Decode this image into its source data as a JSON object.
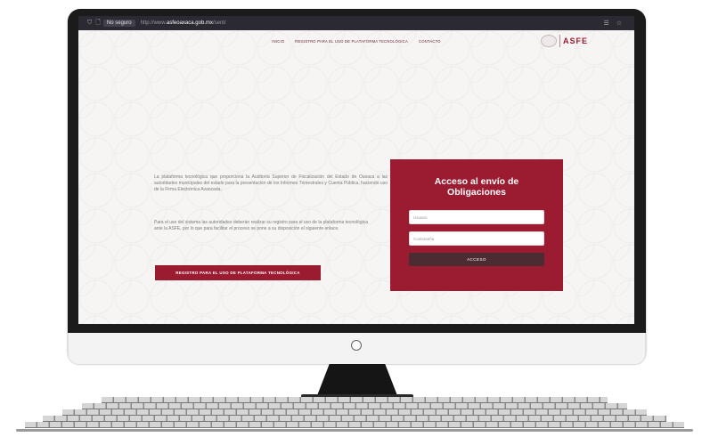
{
  "browser": {
    "insecure_label": "No seguro",
    "url_prefix": "http://www.",
    "url_domain": "asfeoaxaca.gob.mx",
    "url_path": "/sent/"
  },
  "nav": {
    "items": [
      {
        "label": "INICIO"
      },
      {
        "label": "REGISTRO PARA EL USO DE PLATAFORMA TECNOLÓGICA"
      },
      {
        "label": "CONTACTO"
      }
    ]
  },
  "logo": {
    "name": "ASFE"
  },
  "intro": {
    "paragraph1": "La plataforma tecnológica que proporciona la Auditoría Superior de Fiscalización del Estado de Oaxaca a las autoridades municipales del estado para la presentación de los Informes Trimestrales y Cuenta Pública, haciendo uso de la Firma Electrónica Avanzada.",
    "paragraph2": "Para el uso del sistema las autoridades deberán realizar su registro para el uso de la plataforma tecnológica ante la ASFE, por lo que para facilitar el proceso se pone a su disposición el siguiente enlace."
  },
  "register_button": {
    "label": "REGISTRO PARA EL USO DE PLATAFORMA TECNOLÓGICA"
  },
  "login": {
    "title_line1": "Acceso al envío de",
    "title_line2": "Obligaciones",
    "user_placeholder": "Usuario",
    "password_placeholder": "Contraseña",
    "submit_label": "ACCESO"
  },
  "colors": {
    "brand": "#9b1b30",
    "button_dark": "#4b2c33",
    "browser_bar": "#2b2a33"
  },
  "icons": [
    "shield-icon",
    "lock-icon",
    "reader-icon",
    "bookmark-star-icon",
    "power-icon"
  ]
}
